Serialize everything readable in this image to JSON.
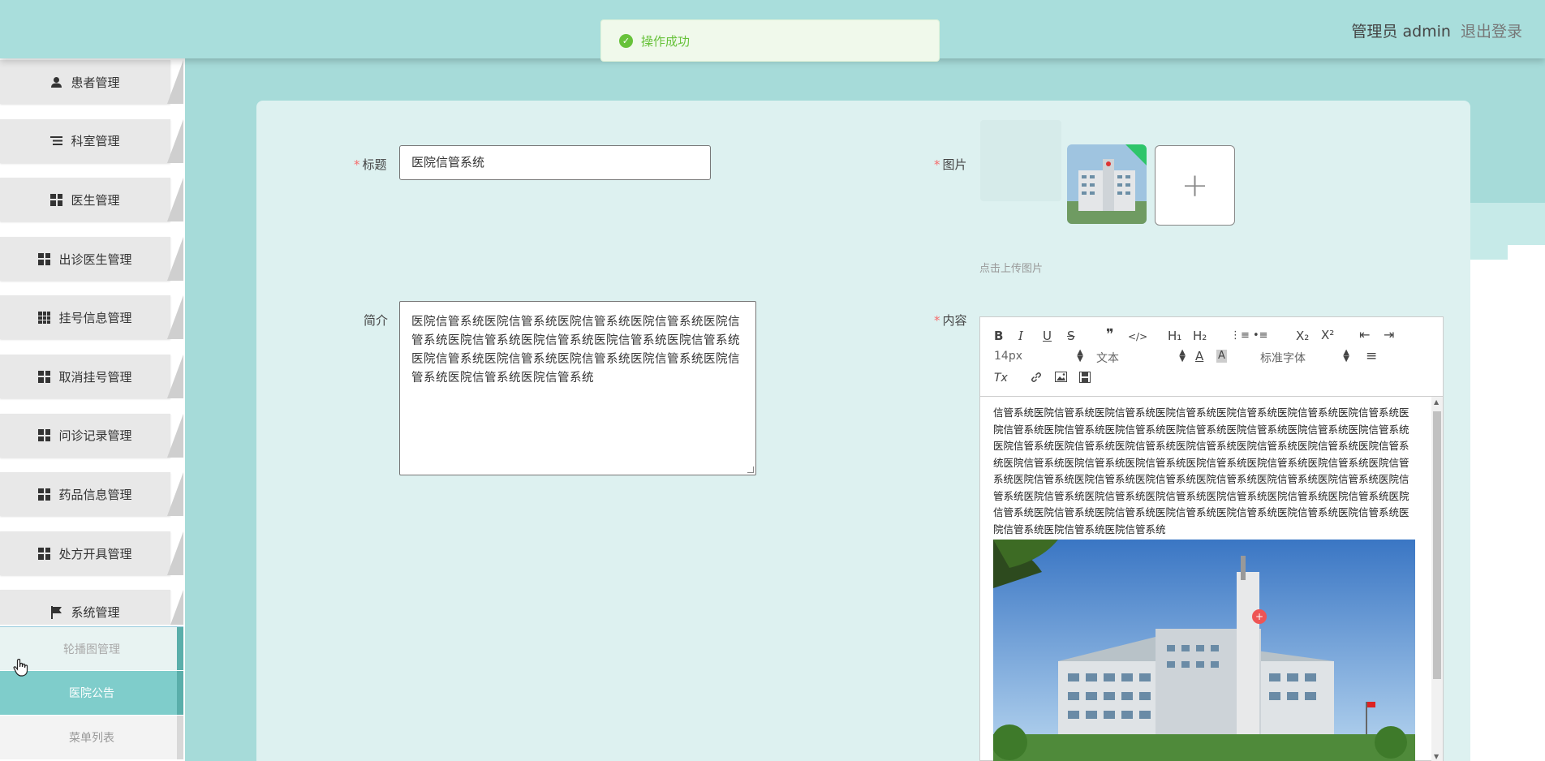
{
  "header": {
    "admin_label": "管理员 admin",
    "logout_label": "退出登录"
  },
  "toast": {
    "icon": "check-circle-icon",
    "message": "操作成功"
  },
  "sidebar": {
    "items": [
      {
        "label": "患者管理",
        "icon": "user-icon"
      },
      {
        "label": "科室管理",
        "icon": "list-icon"
      },
      {
        "label": "医生管理",
        "icon": "grid-icon"
      },
      {
        "label": "出诊医生管理",
        "icon": "grid-icon"
      },
      {
        "label": "挂号信息管理",
        "icon": "grid9-icon"
      },
      {
        "label": "取消挂号管理",
        "icon": "grid-icon"
      },
      {
        "label": "问诊记录管理",
        "icon": "grid-icon"
      },
      {
        "label": "药品信息管理",
        "icon": "grid-icon"
      },
      {
        "label": "处方开具管理",
        "icon": "grid-icon"
      },
      {
        "label": "系统管理",
        "icon": "flag-icon"
      }
    ],
    "submenu": [
      {
        "label": "轮播图管理"
      },
      {
        "label": "医院公告",
        "active": true
      },
      {
        "label": "菜单列表"
      }
    ]
  },
  "form": {
    "title_label": "标题",
    "title_value": "医院信管系统",
    "intro_label": "简介",
    "intro_value": "医院信管系统医院信管系统医院信管系统医院信管系统医院信管系统医院信管系统医院信管系统医院信管系统医院信管系统医院信管系统医院信管系统医院信管系统医院信管系统医院信管系统医院信管系统医院信管系统",
    "image_label": "图片",
    "upload_plus": "+",
    "upload_tip": "点击上传图片",
    "content_label": "内容",
    "required_mark": "*"
  },
  "editor": {
    "toolbar": {
      "bold": "B",
      "italic": "I",
      "underline": "U",
      "strike": "S",
      "quote": "❞",
      "code": "</>",
      "h1": "H₁",
      "h2": "H₂",
      "ordered_list": "⋮≡",
      "bullet_list": "•≡",
      "subscript": "X₂",
      "superscript": "X²",
      "outdent": "⇤",
      "indent": "⇥",
      "font_size": "14px",
      "text_style": "文本",
      "font_family": "标准字体",
      "font_color": "A",
      "bg_color": "A",
      "align": "≡",
      "clear": "Tx",
      "link": "🔗",
      "image": "▣",
      "video": "▦"
    },
    "content_text": "信管系统医院信管系统医院信管系统医院信管系统医院信管系统医院信管系统医院信管系统医院信管系统医院信管系统医院信管系统医院信管系统医院信管系统医院信管系统医院信管系统医院信管系统医院信管系统医院信管系统医院信管系统医院信管系统医院信管系统医院信管系统医院信管系统医院信管系统医院信管系统医院信管系统医院信管系统医院信管系统医院信管系统医院信管系统医院信管系统医院信管系统医院信管系统医院信管系统医院信管系统医院信管系统医院信管系统医院信管系统医院信管系统医院信管系统医院信管系统医院信管系统医院信管系统医院信管系统医院信管系统医院信管系统医院信管系统医院信管系统医院信管系统医院信管系统医院信管系统医院信管系统"
  },
  "colors": {
    "accent": "#a9dedc",
    "active_submenu": "#7fcdcb",
    "success": "#67c23a",
    "required": "#f56c6c"
  }
}
